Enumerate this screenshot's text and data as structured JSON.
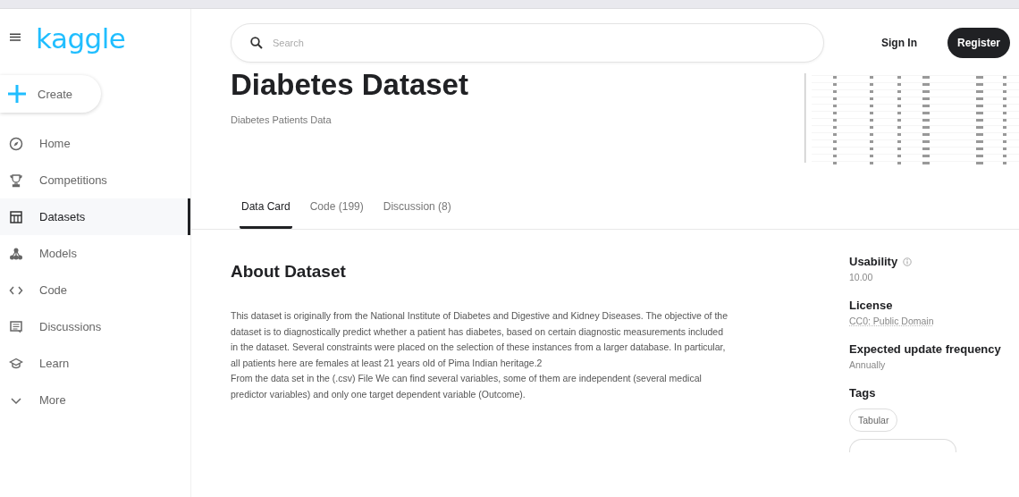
{
  "logo": "kaggle",
  "create_button": "Create",
  "sidebar": {
    "items": [
      {
        "label": "Home",
        "selected": false
      },
      {
        "label": "Competitions",
        "selected": false
      },
      {
        "label": "Datasets",
        "selected": true
      },
      {
        "label": "Models",
        "selected": false
      },
      {
        "label": "Code",
        "selected": false
      },
      {
        "label": "Discussions",
        "selected": false
      },
      {
        "label": "Learn",
        "selected": false
      },
      {
        "label": "More",
        "selected": false
      }
    ]
  },
  "search": {
    "placeholder": "Search"
  },
  "sign_in": "Sign In",
  "register": "Register",
  "dataset": {
    "title": "Diabetes Dataset",
    "subtitle": "Diabetes Patients Data"
  },
  "tabs": [
    {
      "label": "Data Card",
      "selected": true
    },
    {
      "label": "Code (199)",
      "selected": false
    },
    {
      "label": "Discussion (8)",
      "selected": false
    }
  ],
  "about": {
    "heading": "About Dataset",
    "paragraphs": [
      "This dataset is originally from the National Institute of Diabetes and Digestive and Kidney Diseases. The objective of the dataset is to diagnostically predict whether a patient has diabetes, based on certain diagnostic measurements included in the dataset. Several constraints were placed on the selection of these instances from a larger database. In particular, all patients here are females at least 21 years old of Pima Indian heritage.2",
      "From the data set in the (.csv) File We can find several variables, some of them are independent (several medical predictor variables) and only one target dependent variable (Outcome)."
    ]
  },
  "meta": [
    {
      "kind": "info",
      "label": "Usability",
      "value": "10.00"
    },
    {
      "kind": "link",
      "label": "License",
      "value": "CC0: Public Domain"
    },
    {
      "kind": "plain",
      "label": "Expected update frequency",
      "value": "Annually"
    }
  ],
  "tags": {
    "heading": "Tags",
    "items": [
      "Tabular"
    ]
  }
}
